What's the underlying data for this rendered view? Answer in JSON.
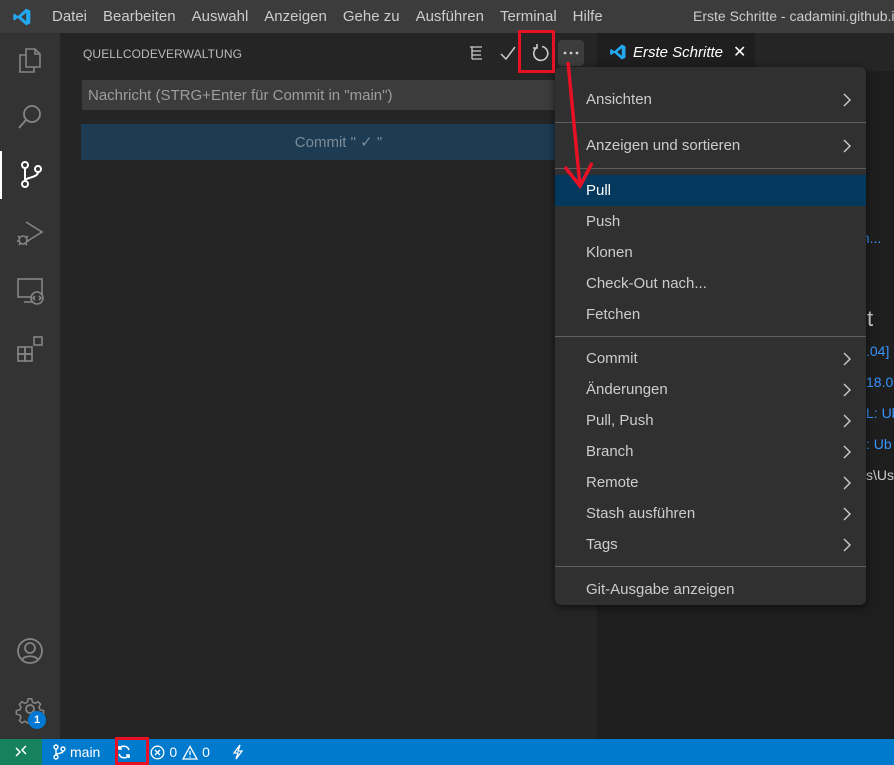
{
  "titlebar": {
    "menu": [
      "Datei",
      "Bearbeiten",
      "Auswahl",
      "Anzeigen",
      "Gehe zu",
      "Ausführen",
      "Terminal",
      "Hilfe"
    ],
    "window_title": "Erste Schritte - cadamini.github.io"
  },
  "activitybar": {
    "items": [
      "explorer-icon",
      "search-icon",
      "source-control-icon",
      "run-debug-icon",
      "remote-explorer-icon",
      "extensions-icon"
    ],
    "active": "source-control-icon",
    "bottom": [
      "accounts-icon",
      "settings-gear-icon"
    ],
    "settings_badge": "1"
  },
  "sidebar": {
    "title": "QUELLCODEVERWALTUNG",
    "actions": [
      "view-as-tree-icon",
      "commit-check-icon",
      "refresh-icon",
      "more-actions-icon"
    ],
    "commit_input_placeholder": "Nachricht (STRG+Enter für Commit in \"main\")",
    "commit_button_label": "Commit \" ✓ \""
  },
  "editor": {
    "tab_label": "Erste Schritte",
    "fragments": [
      "en...",
      "t",
      ".04]",
      "18.0",
      "L: Ub",
      ": Ub",
      "s\\Us"
    ]
  },
  "context_menu": {
    "groups": [
      [
        {
          "label": "Ansichten",
          "submenu": true
        },
        {
          "label": "Anzeigen und sortieren",
          "submenu": true
        }
      ],
      [
        {
          "label": "Pull",
          "submenu": false,
          "selected": true
        },
        {
          "label": "Push",
          "submenu": false
        },
        {
          "label": "Klonen",
          "submenu": false
        },
        {
          "label": "Check-Out nach...",
          "submenu": false
        },
        {
          "label": "Fetchen",
          "submenu": false
        }
      ],
      [
        {
          "label": "Commit",
          "submenu": true
        },
        {
          "label": "Änderungen",
          "submenu": true
        },
        {
          "label": "Pull, Push",
          "submenu": true
        },
        {
          "label": "Branch",
          "submenu": true
        },
        {
          "label": "Remote",
          "submenu": true
        },
        {
          "label": "Stash ausführen",
          "submenu": true
        },
        {
          "label": "Tags",
          "submenu": true
        }
      ],
      [
        {
          "label": "Git-Ausgabe anzeigen",
          "submenu": false
        }
      ]
    ]
  },
  "statusbar": {
    "branch": "main",
    "errors": "0",
    "warnings": "0"
  },
  "colors": {
    "statusbar": "#007acc",
    "remote": "#16825d",
    "menu_selected": "#04395e",
    "annotation": "#e81123"
  }
}
